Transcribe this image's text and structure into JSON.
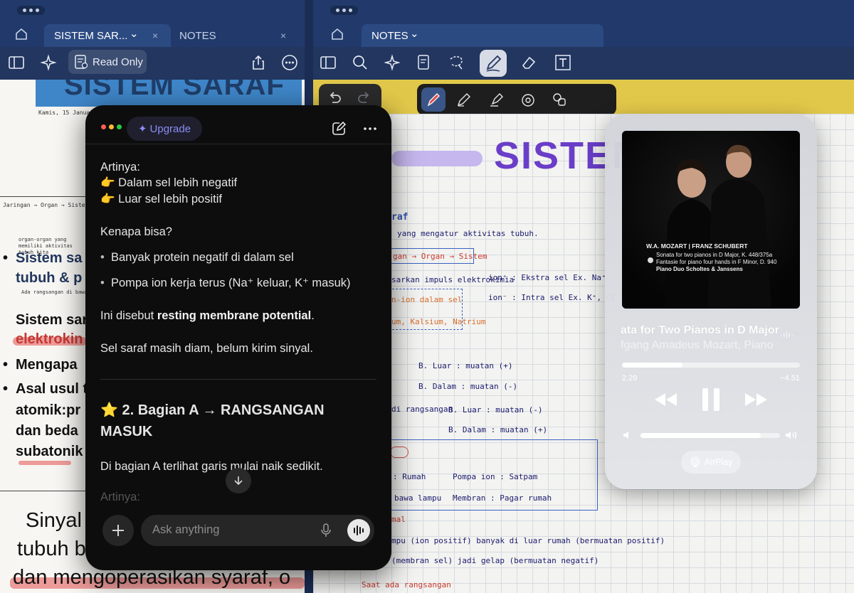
{
  "left_window": {
    "tab_active": "SISTEM SAR...",
    "tab_active_chevron": "⌄",
    "tab_other": "NOTES",
    "tab_close": "×",
    "read_only": "Read Only",
    "page": {
      "banner": "SISTEM SARAF",
      "date": "Kamis, 15 Januari",
      "flow": "Jaringan → Organ → Sistem",
      "side_note": "organ-organ yang memiliki aktivitas tubuh kita",
      "line1": "Sistem sa",
      "line2": "tubuh & p",
      "small_note": "Ada rangsangan di bawah ini",
      "line3": "Sistem sar",
      "line4": "elektrokin",
      "bullet1": "Mengapa",
      "bullet2a": "Asal usul t",
      "bullet2b": "atomik:pr",
      "bullet2c": "dan beda",
      "bullet2d": "subatonik",
      "big1": "Sinyal",
      "big2": "tubuh b",
      "big3": "dan mengoperasikan syaraf, o"
    }
  },
  "right_window": {
    "tab_active": "NOTES",
    "tab_active_chevron": "⌄",
    "page": {
      "title": "SISTEM",
      "n_raf": "raf",
      "n_mengatur": "yang mengatur aktivitas tubuh.",
      "n_flow": "gan → Organ → Sistem",
      "n_sarkan": "sarkan impuls elektrokimia",
      "n_ion_plus": "ion⁺ : Ekstra sel  Ex. Na⁺",
      "n_ion_minus": "ion⁻ : Intra sel  Ex. K⁺, Cl⁻",
      "n_ion_dalam": "n-ion dalam sel",
      "n_kalium": "um, Kalsium, Natrium",
      "n_bluar1": "B. Luar : muatan (+)",
      "n_bdalam1": "B. Dalam : muatan (-)",
      "n_rangsangan": "di rangsangan",
      "n_bluar2": "B. Luar : muatan (-)",
      "n_bdalam2": "B. Dalam : muatan (+)",
      "n_rumah": ": Rumah",
      "n_pompa": "Pompa ion : Satpam",
      "n_lampu": "bawa lampu",
      "n_membran": "Membran : Pagar rumah",
      "n_mal": "mal",
      "n_pu": "mpu (ion positif) banyak di luar rumah (bermuatan positif)",
      "n_membran_sel": "(membran sel) jadi gelap (bermuatan negatif)",
      "n_saat": "Saat ada rangsangan"
    }
  },
  "chat": {
    "upgrade": "Upgrade",
    "artinya": "Artinya:",
    "point1": "Dalam sel lebih negatif",
    "point2": "Luar sel lebih positif",
    "kenapa": "Kenapa bisa?",
    "reason1": "Banyak protein negatif di dalam sel",
    "reason2": "Pompa ion kerja terus (Na⁺ keluar, K⁺ masuk)",
    "disebut_pre": "Ini disebut ",
    "disebut_bold": "resting membrane potential",
    "disebut_post": ".",
    "diam": "Sel saraf masih diam, belum kirim sinyal.",
    "heading": "2. Bagian A → RANGSANGAN MASUK",
    "bagian": "Di bagian A terlihat garis mulai naik sedikit.",
    "artinya2": "Artinya:",
    "ask_placeholder": "Ask anything",
    "emoji_point": "👉",
    "emoji_star": "⭐",
    "bullet": "•"
  },
  "player": {
    "art_line1": "W.A. MOZART | FRANZ SCHUBERT",
    "art_line2": "Sonata for two pianos in D Major, K. 448/375a",
    "art_line3": "Fantasie for piano four hands in F Minor, D. 940",
    "art_line4": "Piano Duo Scholtes & Janssens",
    "song": "ata for Two Pianos in D Major",
    "artist": "fgang Amadeus Mozart, Piano",
    "elapsed": "2.29",
    "remaining": "−4.51",
    "progress_fraction": 0.34,
    "volume_fraction": 0.86,
    "airplay": "AirPlay"
  },
  "colors": {
    "chrome": "#213a6b",
    "chat_bg": "#0d0d0d",
    "accent_purple": "#6a3ec8",
    "upgrade_text": "#8b8cf2"
  }
}
